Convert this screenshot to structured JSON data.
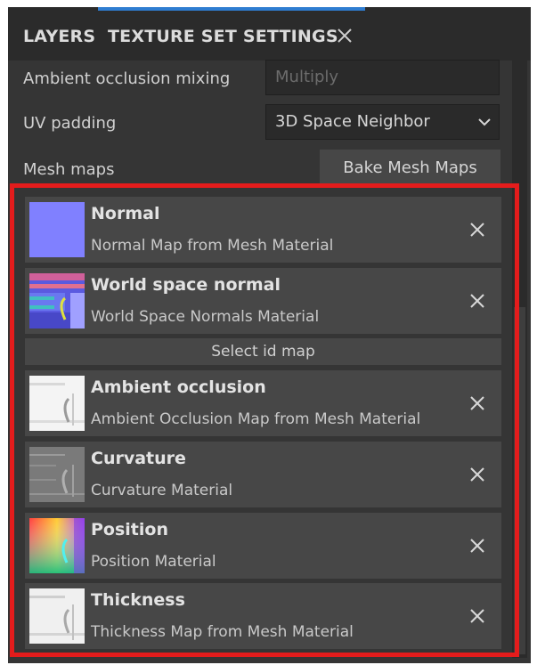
{
  "tabs": {
    "layers_label": "LAYERS",
    "texture_set_settings_label": "TEXTURE SET SETTINGS"
  },
  "settings": {
    "ao_mixing_label": "Ambient occlusion mixing",
    "ao_mixing_value": "Multiply",
    "uv_padding_label": "UV padding",
    "uv_padding_value": "3D Space Neighbor",
    "mesh_maps_label": "Mesh maps",
    "bake_button_label": "Bake Mesh Maps"
  },
  "mesh_maps": [
    {
      "title": "Normal",
      "subtitle": "Normal Map from Mesh Material",
      "icon": "normal-map-thumbnail"
    },
    {
      "title": "World space normal",
      "subtitle": "World Space Normals Material",
      "icon": "world-space-normal-thumbnail"
    },
    {
      "title": "Ambient occlusion",
      "subtitle": "Ambient Occlusion Map from Mesh Material",
      "icon": "ambient-occlusion-thumbnail"
    },
    {
      "title": "Curvature",
      "subtitle": "Curvature Material",
      "icon": "curvature-thumbnail"
    },
    {
      "title": "Position",
      "subtitle": "Position Material",
      "icon": "position-thumbnail"
    },
    {
      "title": "Thickness",
      "subtitle": "Thickness Map from Mesh Material",
      "icon": "thickness-thumbnail"
    }
  ],
  "select_id_map_label": "Select id map",
  "colors": {
    "panel_bg": "#353535",
    "card_bg": "#474747",
    "tab_accent": "#2f7dd1",
    "highlight": "#e41c1c"
  }
}
